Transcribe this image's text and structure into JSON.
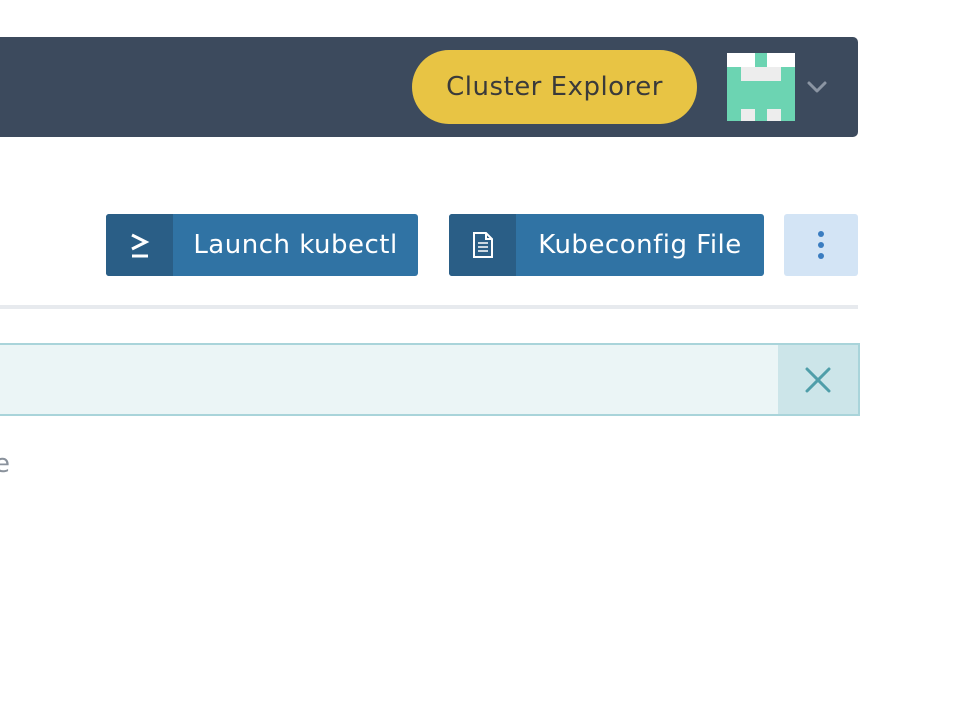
{
  "header": {
    "cluster_explorer_label": "Cluster Explorer",
    "avatar_alt": "User avatar",
    "menu_icon": "chevron-down-icon"
  },
  "actions": {
    "kubectl": {
      "label": "Launch kubectl",
      "icon": "terminal-icon"
    },
    "kubeconfig": {
      "label": "Kubeconfig File",
      "icon": "file-icon"
    },
    "more": {
      "icon": "kebab-menu-icon"
    }
  },
  "banner": {
    "close_icon": "close-icon"
  },
  "body": {
    "partial_text": "e"
  },
  "colors": {
    "header_bg": "#3c4a5d",
    "cluster_explorer_bg": "#e8c444",
    "primary_button": "#3073a4",
    "primary_button_icon_cell": "#2a5e86",
    "secondary_button": "#d3e4f5",
    "banner_bg": "#ebf5f6",
    "banner_border": "#a9d4da",
    "avatar_green": "#6cd4b2"
  }
}
